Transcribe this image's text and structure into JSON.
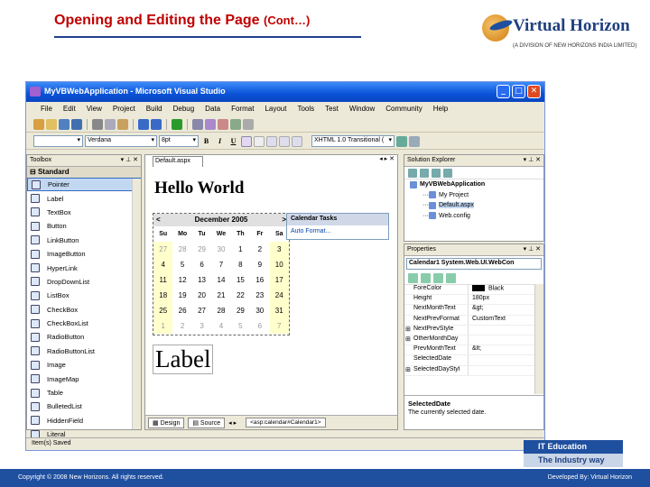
{
  "slide": {
    "title_main": "Opening and Editing the Page",
    "title_suffix": "(Cont…)"
  },
  "logo": {
    "name": "Virtual Horizon",
    "subtitle": "(A DIVISION OF NEW HORIZONS INDIA LIMITED)"
  },
  "window": {
    "title": "MyVBWebApplication - Microsoft Visual Studio"
  },
  "menu": [
    "File",
    "Edit",
    "View",
    "Project",
    "Build",
    "Debug",
    "Data",
    "Format",
    "Layout",
    "Tools",
    "Test",
    "Window",
    "Community",
    "Help"
  ],
  "format_toolbar": {
    "font": "Verdana",
    "size": "8pt",
    "doctype": "XHTML 1.0 Transitional ("
  },
  "toolbox": {
    "title": "Toolbox",
    "section": "Standard",
    "items": [
      "Pointer",
      "Label",
      "TextBox",
      "Button",
      "LinkButton",
      "ImageButton",
      "HyperLink",
      "DropDownList",
      "ListBox",
      "CheckBox",
      "CheckBoxList",
      "RadioButton",
      "RadioButtonList",
      "Image",
      "ImageMap",
      "Table",
      "BulletedList",
      "HiddenField",
      "Literal"
    ]
  },
  "document": {
    "tab": "Default.aspx",
    "heading": "Hello World",
    "calendar": {
      "prev": "<",
      "month": "December 2005",
      "next": ">",
      "days": [
        "Su",
        "Mo",
        "Tu",
        "We",
        "Th",
        "Fr",
        "Sa"
      ],
      "weeks": [
        [
          "27",
          "28",
          "29",
          "30",
          "1",
          "2",
          "3"
        ],
        [
          "4",
          "5",
          "6",
          "7",
          "8",
          "9",
          "10"
        ],
        [
          "11",
          "12",
          "13",
          "14",
          "15",
          "16",
          "17"
        ],
        [
          "18",
          "19",
          "20",
          "21",
          "22",
          "23",
          "24"
        ],
        [
          "25",
          "26",
          "27",
          "28",
          "29",
          "30",
          "31"
        ],
        [
          "1",
          "2",
          "3",
          "4",
          "5",
          "6",
          "7"
        ]
      ]
    },
    "tasks": {
      "title": "Calendar Tasks",
      "item": "Auto Format..."
    },
    "label": "Label",
    "design_tab": "Design",
    "source_tab": "Source",
    "breadcrumb": "<asp:calendar#Calendar1>"
  },
  "solution_explorer": {
    "title": "Solution Explorer",
    "root": "MyVBWebApplication",
    "items": [
      "My Project",
      "Default.aspx",
      "Web.config"
    ]
  },
  "properties": {
    "title": "Properties",
    "object": "Calendar1 System.Web.UI.WebCon",
    "rows": [
      {
        "k": "ForeColor",
        "v": "Black",
        "swatch": true
      },
      {
        "k": "Height",
        "v": "180px"
      },
      {
        "k": "NextMonthText",
        "v": "&gt;"
      },
      {
        "k": "NextPrevFormat",
        "v": "CustomText"
      },
      {
        "k": "NextPrevStyle",
        "v": "",
        "expand": true
      },
      {
        "k": "OtherMonthDay",
        "v": "",
        "expand": true
      },
      {
        "k": "PrevMonthText",
        "v": "&lt;"
      },
      {
        "k": "SelectedDate",
        "v": ""
      },
      {
        "k": "SelectedDayStyl",
        "v": "",
        "expand": true
      }
    ],
    "desc_title": "SelectedDate",
    "desc_text": "The currently selected date."
  },
  "statusbar": "Item(s) Saved",
  "badge": {
    "top": "IT Education",
    "bottom": "The Industry way"
  },
  "footer": {
    "left": "Copyright © 2008 New Horizons. All rights reserved.",
    "right": "Developed By: Virtual Horizon"
  }
}
